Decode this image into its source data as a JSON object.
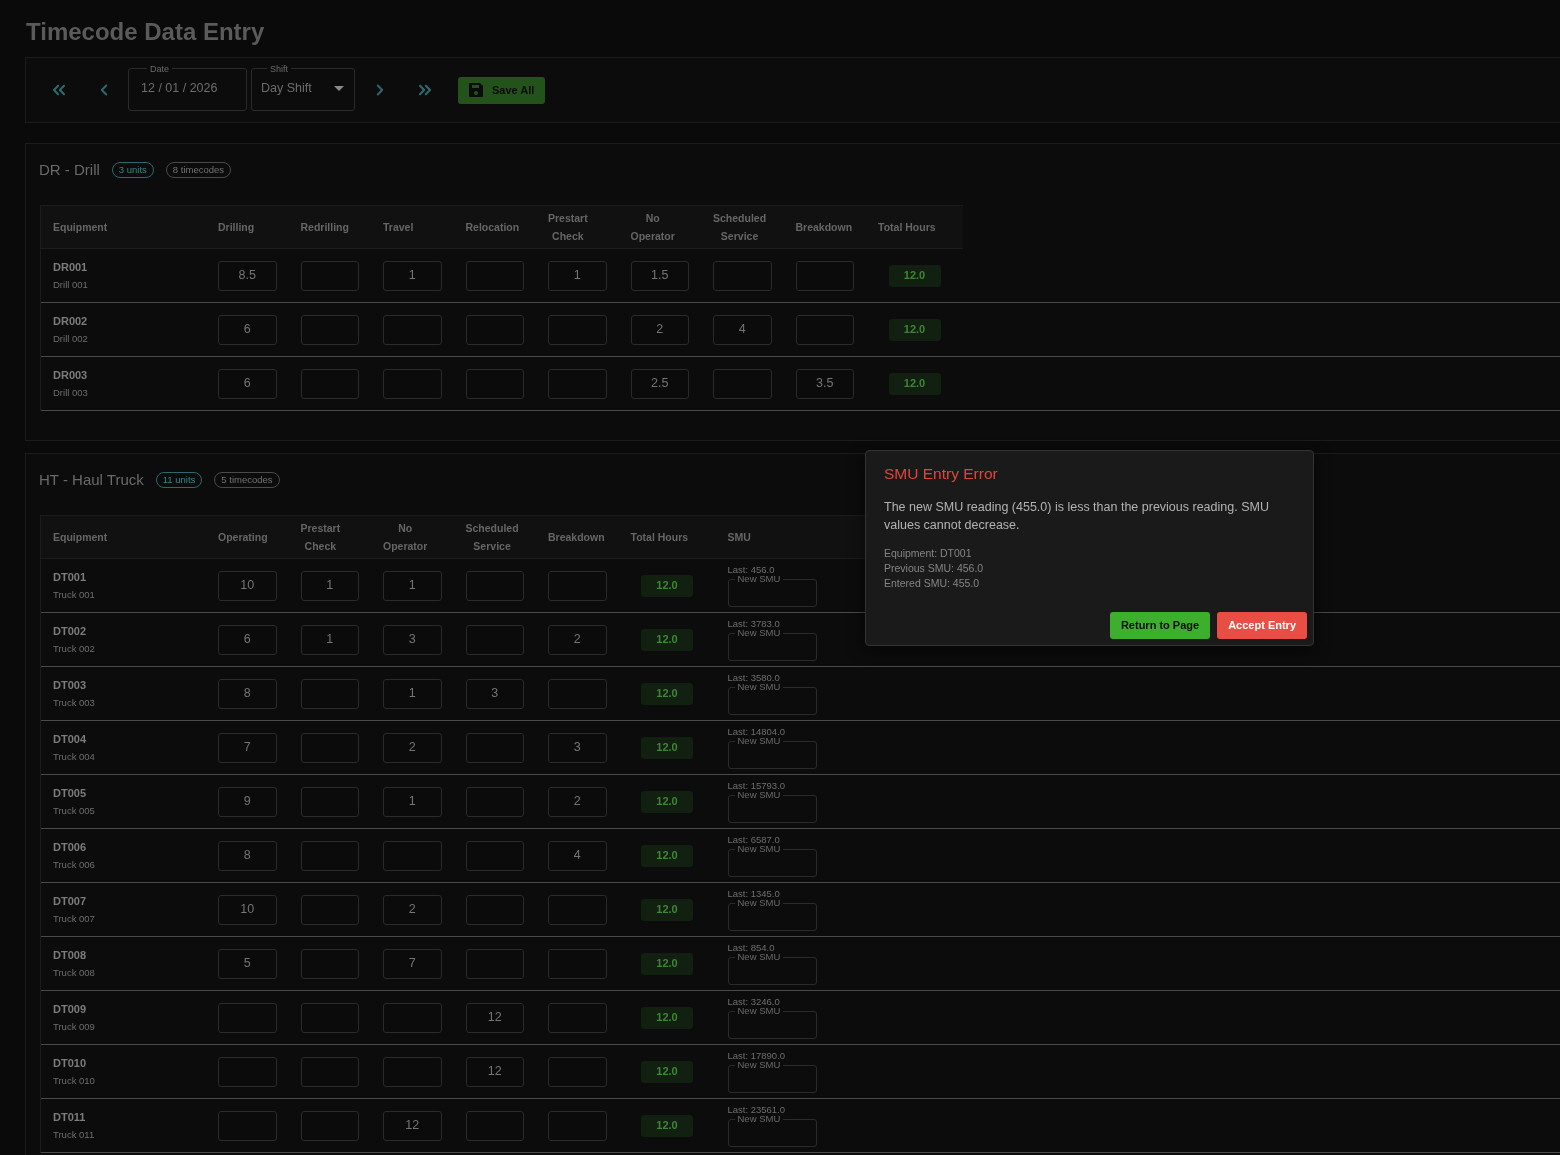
{
  "page": {
    "title": "Timecode Data Entry"
  },
  "toolbar": {
    "date": {
      "label": "Date",
      "value": "12 / 01 / 2026"
    },
    "shift": {
      "label": "Shift",
      "value": "Day Shift"
    },
    "save_button": {
      "label": "Save All"
    }
  },
  "sections": [
    {
      "title": "DR - Drill",
      "units": "3 units",
      "timecodes": "8 timecodes",
      "columns": [
        {
          "label": "Equipment",
          "kind": "equipment"
        },
        {
          "label": "Drilling",
          "kind": "hours"
        },
        {
          "label": "Redrilling",
          "kind": "hours"
        },
        {
          "label": "Travel",
          "kind": "hours"
        },
        {
          "label": "Relocation",
          "kind": "hours"
        },
        {
          "label": "Prestart Check",
          "kind": "hours"
        },
        {
          "label": "No Operator",
          "kind": "hours"
        },
        {
          "label": "Scheduled Service",
          "kind": "hours"
        },
        {
          "label": "Breakdown",
          "kind": "hours"
        },
        {
          "label": "Total Hours",
          "kind": "total"
        }
      ],
      "rows": [
        {
          "code": "DR001",
          "name": "Drill 001",
          "hours": [
            {
              "kind": "filled",
              "value": "8.5"
            },
            {
              "kind": "blank"
            },
            {
              "kind": "filled",
              "value": "1"
            },
            {
              "kind": "blank"
            },
            {
              "kind": "filled",
              "value": "1"
            },
            {
              "kind": "filled",
              "value": "1.5"
            },
            {
              "kind": "blank"
            },
            {
              "kind": "blank"
            }
          ],
          "total": "12.0"
        },
        {
          "code": "DR002",
          "name": "Drill 002",
          "hours": [
            {
              "kind": "filled",
              "value": "6"
            },
            {
              "kind": "blank"
            },
            {
              "kind": "blank"
            },
            {
              "kind": "blank"
            },
            {
              "kind": "blank"
            },
            {
              "kind": "filled",
              "value": "2"
            },
            {
              "kind": "filled",
              "value": "4"
            },
            {
              "kind": "blank"
            }
          ],
          "total": "12.0"
        },
        {
          "code": "DR003",
          "name": "Drill 003",
          "hours": [
            {
              "kind": "filled",
              "value": "6"
            },
            {
              "kind": "blank"
            },
            {
              "kind": "blank"
            },
            {
              "kind": "blank"
            },
            {
              "kind": "blank"
            },
            {
              "kind": "filled",
              "value": "2.5"
            },
            {
              "kind": "blank"
            },
            {
              "kind": "filled",
              "value": "3.5"
            }
          ],
          "total": "12.0"
        }
      ]
    },
    {
      "title": "HT - Haul Truck",
      "units": "11 units",
      "timecodes": "5 timecodes",
      "columns": [
        {
          "label": "Equipment",
          "kind": "equipment"
        },
        {
          "label": "Operating",
          "kind": "hours"
        },
        {
          "label": "Prestart Check",
          "kind": "hours"
        },
        {
          "label": "No Operator",
          "kind": "hours"
        },
        {
          "label": "Scheduled Service",
          "kind": "hours"
        },
        {
          "label": "Breakdown",
          "kind": "hours"
        },
        {
          "label": "Total Hours",
          "kind": "total"
        },
        {
          "label": "SMU",
          "kind": "smu"
        }
      ],
      "rows": [
        {
          "code": "DT001",
          "name": "Truck 001",
          "hours": [
            {
              "kind": "filled",
              "value": "10"
            },
            {
              "kind": "filled",
              "value": "1"
            },
            {
              "kind": "filled",
              "value": "1"
            },
            {
              "kind": "blank"
            },
            {
              "kind": "blank"
            }
          ],
          "total": "12.0",
          "smu": {
            "last": "Last: 456.0",
            "label": "New SMU"
          }
        },
        {
          "code": "DT002",
          "name": "Truck 002",
          "hours": [
            {
              "kind": "filled",
              "value": "6"
            },
            {
              "kind": "filled",
              "value": "1"
            },
            {
              "kind": "filled",
              "value": "3"
            },
            {
              "kind": "blank"
            },
            {
              "kind": "filled",
              "value": "2"
            }
          ],
          "total": "12.0",
          "smu": {
            "last": "Last: 3783.0",
            "label": "New SMU"
          }
        },
        {
          "code": "DT003",
          "name": "Truck 003",
          "hours": [
            {
              "kind": "filled",
              "value": "8"
            },
            {
              "kind": "blank"
            },
            {
              "kind": "filled",
              "value": "1"
            },
            {
              "kind": "filled",
              "value": "3"
            },
            {
              "kind": "blank"
            }
          ],
          "total": "12.0",
          "smu": {
            "last": "Last: 3580.0",
            "label": "New SMU"
          }
        },
        {
          "code": "DT004",
          "name": "Truck 004",
          "hours": [
            {
              "kind": "filled",
              "value": "7"
            },
            {
              "kind": "blank"
            },
            {
              "kind": "filled",
              "value": "2"
            },
            {
              "kind": "blank"
            },
            {
              "kind": "filled",
              "value": "3"
            }
          ],
          "total": "12.0",
          "smu": {
            "last": "Last: 14804.0",
            "label": "New SMU"
          }
        },
        {
          "code": "DT005",
          "name": "Truck 005",
          "hours": [
            {
              "kind": "filled",
              "value": "9"
            },
            {
              "kind": "blank"
            },
            {
              "kind": "filled",
              "value": "1"
            },
            {
              "kind": "blank"
            },
            {
              "kind": "filled",
              "value": "2"
            }
          ],
          "total": "12.0",
          "smu": {
            "last": "Last: 15793.0",
            "label": "New SMU"
          }
        },
        {
          "code": "DT006",
          "name": "Truck 006",
          "hours": [
            {
              "kind": "filled",
              "value": "8"
            },
            {
              "kind": "blank"
            },
            {
              "kind": "blank"
            },
            {
              "kind": "blank"
            },
            {
              "kind": "filled",
              "value": "4"
            }
          ],
          "total": "12.0",
          "smu": {
            "last": "Last: 6587.0",
            "label": "New SMU"
          }
        },
        {
          "code": "DT007",
          "name": "Truck 007",
          "hours": [
            {
              "kind": "filled",
              "value": "10"
            },
            {
              "kind": "blank"
            },
            {
              "kind": "filled",
              "value": "2"
            },
            {
              "kind": "blank"
            },
            {
              "kind": "blank"
            }
          ],
          "total": "12.0",
          "smu": {
            "last": "Last: 1345.0",
            "label": "New SMU"
          }
        },
        {
          "code": "DT008",
          "name": "Truck 008",
          "hours": [
            {
              "kind": "filled",
              "value": "5"
            },
            {
              "kind": "blank"
            },
            {
              "kind": "filled",
              "value": "7"
            },
            {
              "kind": "blank"
            },
            {
              "kind": "blank"
            }
          ],
          "total": "12.0",
          "smu": {
            "last": "Last: 854.0",
            "label": "New SMU"
          }
        },
        {
          "code": "DT009",
          "name": "Truck 009",
          "hours": [
            {
              "kind": "blank"
            },
            {
              "kind": "blank"
            },
            {
              "kind": "blank"
            },
            {
              "kind": "filled",
              "value": "12"
            },
            {
              "kind": "blank"
            }
          ],
          "total": "12.0",
          "smu": {
            "last": "Last: 3246.0",
            "label": "New SMU"
          }
        },
        {
          "code": "DT010",
          "name": "Truck 010",
          "hours": [
            {
              "kind": "blank"
            },
            {
              "kind": "blank"
            },
            {
              "kind": "blank"
            },
            {
              "kind": "filled",
              "value": "12"
            },
            {
              "kind": "blank"
            }
          ],
          "total": "12.0",
          "smu": {
            "last": "Last: 17890.0",
            "label": "New SMU"
          }
        },
        {
          "code": "DT011",
          "name": "Truck 011",
          "hours": [
            {
              "kind": "blank"
            },
            {
              "kind": "blank"
            },
            {
              "kind": "filled",
              "value": "12"
            },
            {
              "kind": "blank"
            },
            {
              "kind": "blank"
            }
          ],
          "total": "12.0",
          "smu": {
            "last": "Last: 23561.0",
            "label": "New SMU"
          }
        }
      ]
    }
  ],
  "dialog": {
    "title": "SMU Entry Error",
    "message": "The new SMU reading (455.0) is less than the previous reading. SMU values cannot decrease.",
    "details": [
      "Equipment: DT001",
      "Previous SMU: 456.0",
      "Entered SMU: 455.0"
    ],
    "buttons": [
      {
        "label": "Return to Page",
        "kind": "success"
      },
      {
        "label": "Accept Entry",
        "kind": "danger"
      }
    ]
  }
}
